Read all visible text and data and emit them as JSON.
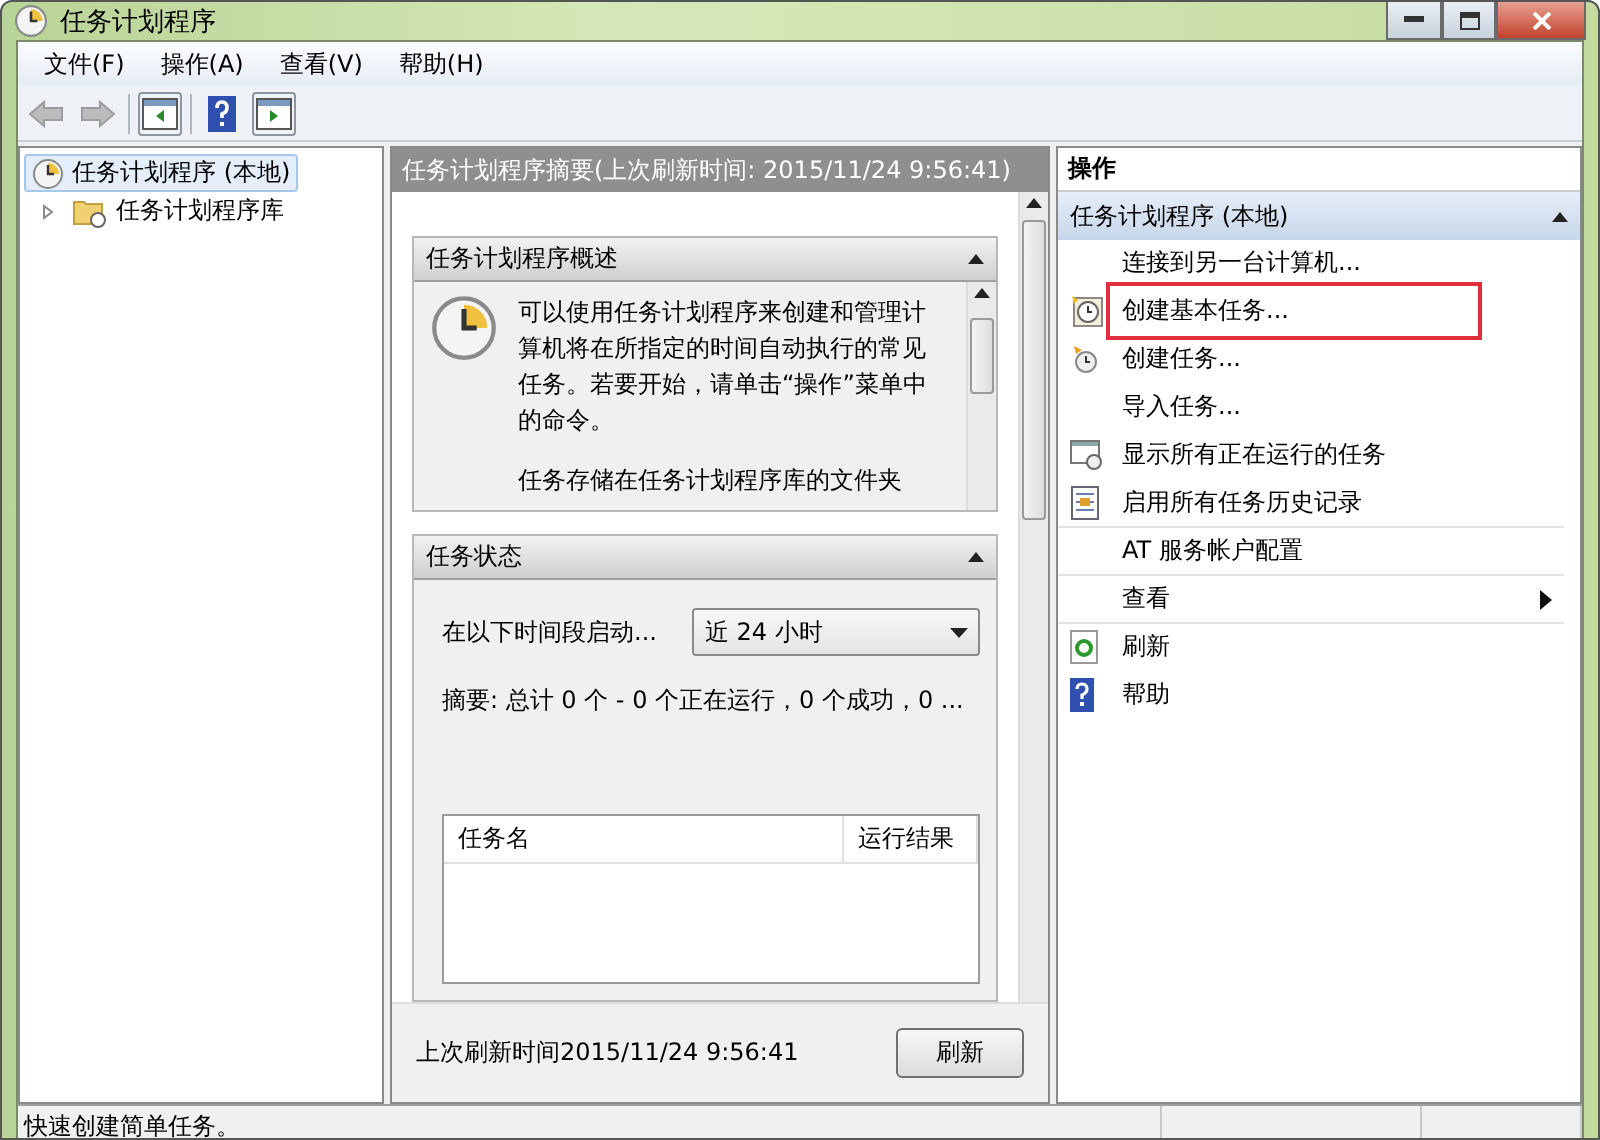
{
  "window": {
    "title": "任务计划程序"
  },
  "menu": [
    "文件(F)",
    "操作(A)",
    "查看(V)",
    "帮助(H)"
  ],
  "toolbar": [
    {
      "kind": "back",
      "disabled": true
    },
    {
      "kind": "forward",
      "disabled": true
    },
    {
      "kind": "tree",
      "disabled": false
    },
    {
      "kind": "help",
      "disabled": false
    },
    {
      "kind": "pane",
      "disabled": false
    }
  ],
  "tree": [
    {
      "label": "任务计划程序 (本地)",
      "selected": true,
      "children": [
        {
          "label": "任务计划程序库",
          "selected": false,
          "expanded": false
        }
      ]
    }
  ],
  "summary": {
    "header": "任务计划程序摘要(上次刷新时间: 2015/11/24 9:56:41)",
    "overview": {
      "title": "任务计划程序概述",
      "text": "可以使用任务计划程序来创建和管理计算机将在所指定的时间自动执行的常见任务。若要开始，请单击“操作”菜单中的命令。",
      "more": "任务存储在任务计划程序库的文件夹"
    },
    "status": {
      "title": "任务状态",
      "period_label": "在以下时间段启动...",
      "period_value": "近 24 小时",
      "summary": "摘要: 总计 0 个 - 0 个正在运行，0 个成功，0 ...",
      "columns": [
        "任务名",
        "运行结果"
      ]
    },
    "last_refresh": "上次刷新时间2015/11/24 9:56:41",
    "refresh_button": "刷新"
  },
  "actions": {
    "title": "操作",
    "group": "任务计划程序 (本地)",
    "items": [
      {
        "label": "连接到另一台计算机...",
        "highlighted": false,
        "submenu": false,
        "separator_after": false
      },
      {
        "label": "创建基本任务...",
        "highlighted": true,
        "submenu": false,
        "separator_after": false
      },
      {
        "label": "创建任务...",
        "highlighted": false,
        "submenu": false,
        "separator_after": false
      },
      {
        "label": "导入任务...",
        "highlighted": false,
        "submenu": false,
        "separator_after": false
      },
      {
        "label": "显示所有正在运行的任务",
        "highlighted": false,
        "submenu": false,
        "separator_after": false
      },
      {
        "label": "启用所有任务历史记录",
        "highlighted": false,
        "submenu": false,
        "separator_after": true
      },
      {
        "label": "AT 服务帐户配置",
        "highlighted": false,
        "submenu": false,
        "separator_after": true
      },
      {
        "label": "查看",
        "highlighted": false,
        "submenu": true,
        "separator_after": true
      },
      {
        "label": "刷新",
        "highlighted": false,
        "submenu": false,
        "separator_after": false
      },
      {
        "label": "帮助",
        "highlighted": false,
        "submenu": false,
        "separator_after": false
      }
    ]
  },
  "status_bar": "快速创建简单任务。"
}
